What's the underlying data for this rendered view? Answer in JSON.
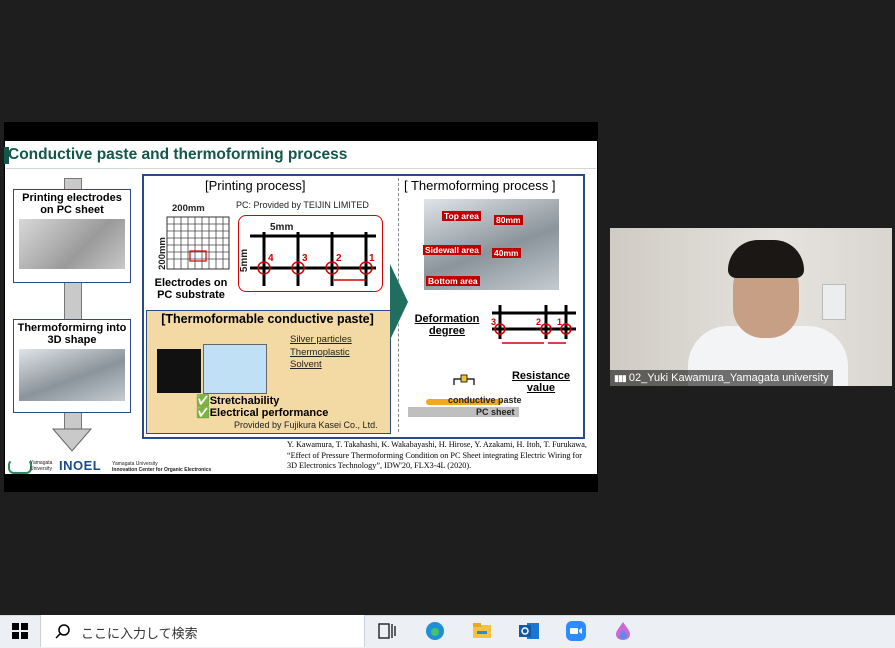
{
  "slide": {
    "title": "Conductive paste and thermoforming process",
    "left_steps": {
      "step1": "Printing electrodes on PC sheet",
      "step2": "Thermoformirng into 3D shape"
    },
    "printing_process": {
      "heading": "[Printing process]",
      "pc_note": "PC: Provided by TEIJIN LIMITED",
      "dim_x": "200mm",
      "dim_y": "200mm",
      "caption": "Electrodes on PC substrate",
      "zoom_dim_x": "5mm",
      "zoom_dim_y": "5mm",
      "points": [
        "4",
        "3",
        "2",
        "1"
      ]
    },
    "paste": {
      "heading": "[Thermoformable conductive paste]",
      "items": [
        "Silver particles",
        "Thermoplastic",
        "Solvent"
      ],
      "check1": "Stretchability",
      "check2": "Electrical performance",
      "provider": "Provided by Fujikura Kasei Co., Ltd."
    },
    "thermoforming": {
      "heading": "[ Thermoforming process ]",
      "top_area": "Top area",
      "sidewall_area": "Sidewall area",
      "bottom_area": "Bottom area",
      "dim_top": "80mm",
      "dim_side": "40mm",
      "deformation": "Deformation degree",
      "resistance": "Resistance value",
      "paste_label": "conductive paste",
      "sheet_label": "PC sheet",
      "points": [
        "3",
        "2",
        "1"
      ]
    },
    "reference": "Y. Kawamura, T. Takahashi, K. Wakabayashi, H. Hirose, Y. Azakami, H. Itoh, T. Furukawa, “Effect of Pressure Thermoforming Condition on PC Sheet integrating Electric Wiring for 3D Electronics Technology”, IDW'20, FLX3-4L (2020).",
    "footer": {
      "univ": "Yamagata University",
      "logo": "INOEL",
      "center_line1": "Yamagata University",
      "center_line2": "Innovation Center for Organic Electronics"
    }
  },
  "video": {
    "participant_name": "02_Yuki Kawamura_Yamagata university"
  },
  "taskbar": {
    "search_placeholder": "ここに入力して検索",
    "apps": [
      "task-view-icon",
      "edge-icon",
      "file-explorer-icon",
      "outlook-icon",
      "zoom-icon",
      "app-drop-icon"
    ]
  }
}
